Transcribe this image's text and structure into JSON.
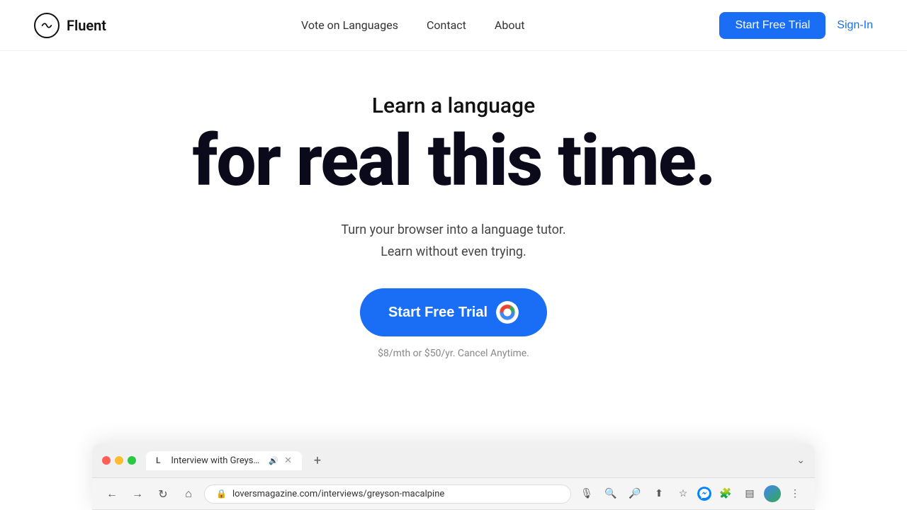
{
  "nav": {
    "logo_text": "Fluent",
    "links": [
      {
        "label": "Vote on Languages",
        "id": "vote-on-languages"
      },
      {
        "label": "Contact",
        "id": "contact"
      },
      {
        "label": "About",
        "id": "about"
      }
    ],
    "trial_button": "Start Free Trial",
    "signin_button": "Sign-In"
  },
  "hero": {
    "subtitle": "Learn a language",
    "title": "for real this time.",
    "description_line1": "Turn your browser into a language tutor.",
    "description_line2": "Learn without even trying.",
    "cta_button": "Start Free Trial",
    "pricing": "$8/mth or $50/yr. Cancel Anytime."
  },
  "browser": {
    "tab_title": "Interview with Greyson Ma...",
    "tab_favicon": "L",
    "url": "loversmagazine.com/interviews/greyson-macalpine"
  }
}
